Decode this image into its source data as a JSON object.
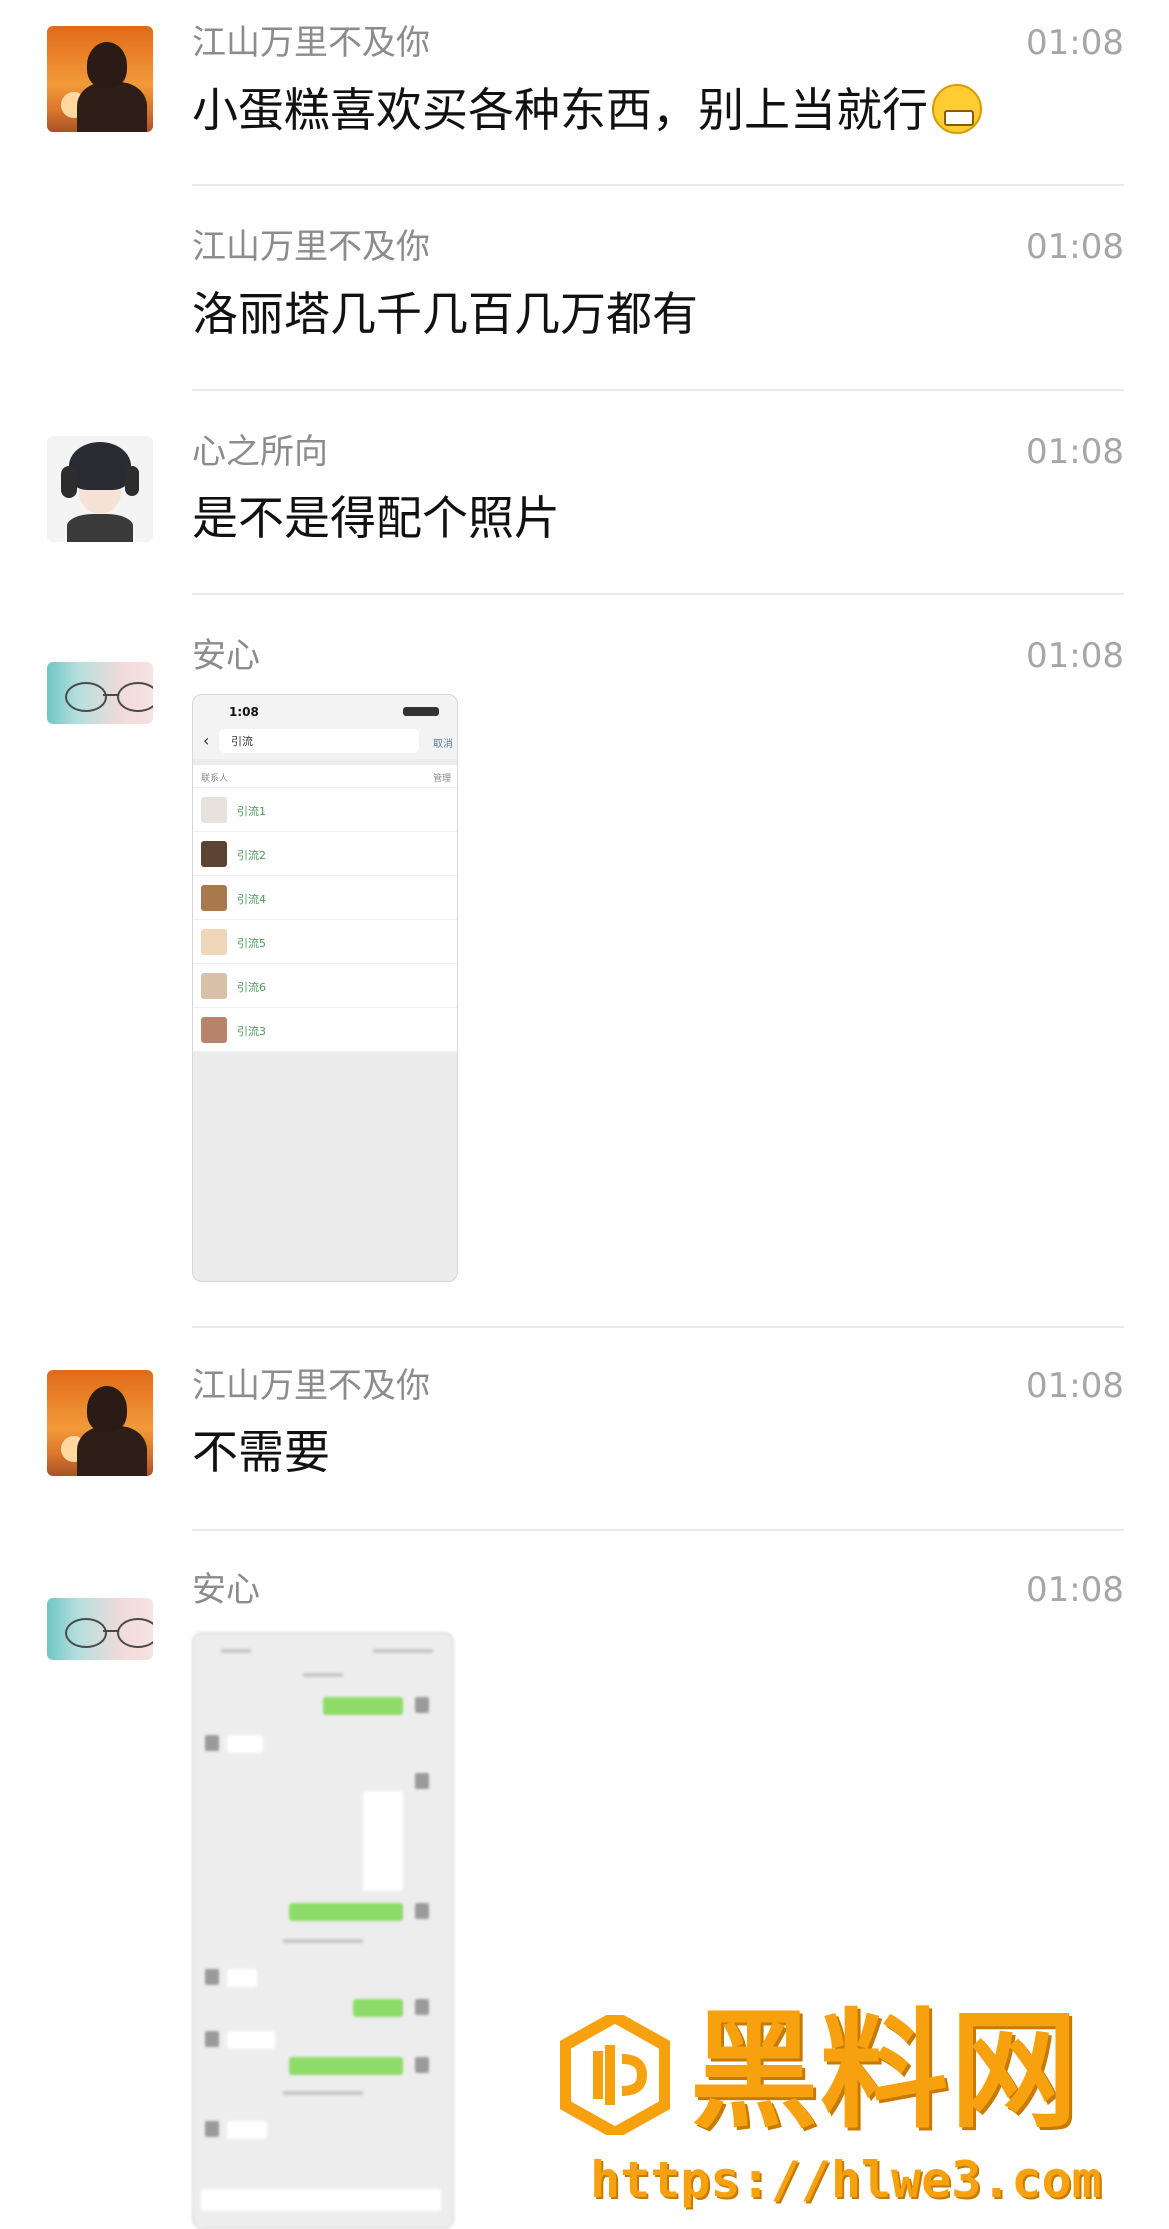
{
  "messages": [
    {
      "sender": "江山万里不及你",
      "time": "01:08",
      "text": "小蛋糕喜欢买各种东西，别上当就行"
    },
    {
      "sender": "江山万里不及你",
      "time": "01:08",
      "text": "洛丽塔几千几百几万都有"
    },
    {
      "sender": "心之所向",
      "time": "01:08",
      "text": "是不是得配个照片"
    },
    {
      "sender": "安心",
      "time": "01:08"
    },
    {
      "sender": "江山万里不及你",
      "time": "01:08",
      "text": "不需要"
    },
    {
      "sender": "安心",
      "time": "01:08"
    }
  ],
  "screenshot1": {
    "status_time": "1:08",
    "search_query": "引流",
    "cancel_label": "取消",
    "section_label": "联系人",
    "manage_label": "管理",
    "contacts": [
      "引流1",
      "引流2",
      "引流4",
      "引流5",
      "引流6",
      "引流3"
    ],
    "contact_colors": [
      "#e8e2dc",
      "#5a4332",
      "#a9794e",
      "#f1d7b9",
      "#d8c1a8",
      "#b7846b"
    ]
  },
  "watermark": {
    "brand": "黑料网",
    "url": "https://hlwe3.com",
    "color": "#f7a10e"
  }
}
